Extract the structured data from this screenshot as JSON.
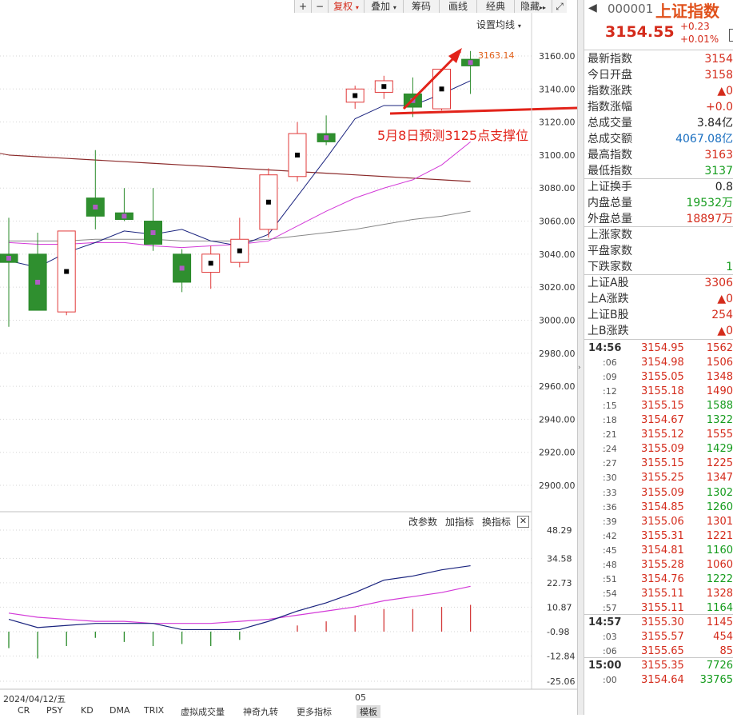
{
  "toolbar": {
    "plus": "+",
    "minus": "−",
    "fuquan": "复权",
    "diejia": "叠加",
    "chouma": "筹码",
    "huaxian": "画线",
    "jingdian": "经典",
    "yincang": "隐藏",
    "expand": "⤢"
  },
  "ma_setting": "设置均线",
  "annotation": "5月8日预测3125点支撑位",
  "high_label": "3163.14",
  "price_axis": [
    "3160.00",
    "3140.00",
    "3120.00",
    "3100.00",
    "3080.00",
    "3060.00",
    "3040.00",
    "3020.00",
    "3000.00",
    "2980.00",
    "2960.00",
    "2940.00",
    "2920.00",
    "2900.00"
  ],
  "indicator_toolbar": {
    "change_params": "改参数",
    "add_indicator": "加指标",
    "switch_indicator": "换指标",
    "close": "✕"
  },
  "indicator_axis": [
    "48.29",
    "34.58",
    "22.73",
    "10.87",
    "-0.98",
    "-12.84",
    "-25.06"
  ],
  "date_axis": {
    "start": "2024/04/12/五",
    "month": "05"
  },
  "bottom_tabs": [
    "CR",
    "PSY",
    "KD",
    "DMA",
    "TRIX",
    "虚拟成交量",
    "神奇九转",
    "更多指标",
    "模板"
  ],
  "header": {
    "code": "000001",
    "name": "上证指数",
    "price": "3154.55",
    "change": "+0.23",
    "change_pct": "+0.01%"
  },
  "quote": [
    {
      "label": "最新指数",
      "value": "3154",
      "color": "red"
    },
    {
      "label": "今日开盘",
      "value": "3158",
      "color": "red"
    },
    {
      "label": "指数涨跌",
      "value": "▲0",
      "color": "red"
    },
    {
      "label": "指数涨幅",
      "value": "+0.0",
      "color": "red"
    },
    {
      "label": "总成交量",
      "value": "3.84亿",
      "color": "black"
    },
    {
      "label": "总成交额",
      "value": "4067.08亿",
      "color": "blue"
    },
    {
      "label": "最高指数",
      "value": "3163",
      "color": "red"
    },
    {
      "label": "最低指数",
      "value": "3137",
      "color": "green"
    },
    {
      "label": "上证换手",
      "value": "0.8",
      "color": "black"
    },
    {
      "label": "内盘总量",
      "value": "19532万",
      "color": "green"
    },
    {
      "label": "外盘总量",
      "value": "18897万",
      "color": "red"
    },
    {
      "label": "上涨家数",
      "value": "",
      "color": "red"
    },
    {
      "label": "平盘家数",
      "value": "",
      "color": "black"
    },
    {
      "label": "下跌家数",
      "value": "1",
      "color": "green"
    },
    {
      "label": "上证A股",
      "value": "3306",
      "color": "red"
    },
    {
      "label": "上A涨跌",
      "value": "▲0",
      "color": "red"
    },
    {
      "label": "上证B股",
      "value": "254",
      "color": "red"
    },
    {
      "label": "上B涨跌",
      "value": "▲0",
      "color": "red"
    }
  ],
  "ticks": [
    {
      "time": "14:56",
      "price": "3154.95",
      "vol": "1562",
      "color": "red",
      "major": true
    },
    {
      "time": ":06",
      "price": "3154.98",
      "vol": "1506",
      "color": "red"
    },
    {
      "time": ":09",
      "price": "3155.05",
      "vol": "1348",
      "color": "red"
    },
    {
      "time": ":12",
      "price": "3155.18",
      "vol": "1490",
      "color": "red"
    },
    {
      "time": ":15",
      "price": "3155.15",
      "vol": "1588",
      "color": "green"
    },
    {
      "time": ":18",
      "price": "3154.67",
      "vol": "1322",
      "color": "green"
    },
    {
      "time": ":21",
      "price": "3155.12",
      "vol": "1555",
      "color": "red"
    },
    {
      "time": ":24",
      "price": "3155.09",
      "vol": "1429",
      "color": "green"
    },
    {
      "time": ":27",
      "price": "3155.15",
      "vol": "1225",
      "color": "red"
    },
    {
      "time": ":30",
      "price": "3155.25",
      "vol": "1347",
      "color": "red"
    },
    {
      "time": ":33",
      "price": "3155.09",
      "vol": "1302",
      "color": "green"
    },
    {
      "time": ":36",
      "price": "3154.85",
      "vol": "1260",
      "color": "green"
    },
    {
      "time": ":39",
      "price": "3155.06",
      "vol": "1301",
      "color": "red"
    },
    {
      "time": ":42",
      "price": "3155.31",
      "vol": "1221",
      "color": "red"
    },
    {
      "time": ":45",
      "price": "3154.81",
      "vol": "1160",
      "color": "green"
    },
    {
      "time": ":48",
      "price": "3155.28",
      "vol": "1060",
      "color": "red"
    },
    {
      "time": ":51",
      "price": "3154.76",
      "vol": "1222",
      "color": "green"
    },
    {
      "time": ":54",
      "price": "3155.11",
      "vol": "1328",
      "color": "red"
    },
    {
      "time": ":57",
      "price": "3155.11",
      "vol": "1164",
      "color": "green"
    },
    {
      "time": "14:57",
      "price": "3155.30",
      "vol": "1145",
      "color": "red",
      "major": true
    },
    {
      "time": ":03",
      "price": "3155.57",
      "vol": "454",
      "color": "red"
    },
    {
      "time": ":06",
      "price": "3155.65",
      "vol": "85",
      "color": "red"
    },
    {
      "time": "15:00",
      "price": "3155.35",
      "vol": "7726",
      "color": "green",
      "major": true
    },
    {
      "time": ":00",
      "price": "3154.64",
      "vol": "33765",
      "color": "green"
    }
  ],
  "chart_data": {
    "type": "candlestick",
    "candles": [
      {
        "o": 3040,
        "h": 3062,
        "l": 2996,
        "c": 3035
      },
      {
        "o": 3040,
        "h": 3053,
        "l": 3006,
        "c": 3006
      },
      {
        "o": 3005,
        "h": 3054,
        "l": 3003,
        "c": 3054
      },
      {
        "o": 3074,
        "h": 3103,
        "l": 3055,
        "c": 3063
      },
      {
        "o": 3065,
        "h": 3080,
        "l": 3060,
        "c": 3061
      },
      {
        "o": 3060,
        "h": 3080,
        "l": 3042,
        "c": 3046
      },
      {
        "o": 3040,
        "h": 3043,
        "l": 3017,
        "c": 3023
      },
      {
        "o": 3029,
        "h": 3045,
        "l": 3019,
        "c": 3040
      },
      {
        "o": 3035,
        "h": 3062,
        "l": 3032,
        "c": 3049
      },
      {
        "o": 3055,
        "h": 3092,
        "l": 3050,
        "c": 3088
      },
      {
        "o": 3087,
        "h": 3120,
        "l": 3084,
        "c": 3113
      },
      {
        "o": 3113,
        "h": 3124,
        "l": 3106,
        "c": 3108
      },
      {
        "o": 3132,
        "h": 3142,
        "l": 3128,
        "c": 3140
      },
      {
        "o": 3138,
        "h": 3148,
        "l": 3134,
        "c": 3145
      },
      {
        "o": 3137,
        "h": 3147,
        "l": 3123,
        "c": 3129
      },
      {
        "o": 3128,
        "h": 3150,
        "l": 3127,
        "c": 3152
      },
      {
        "o": 3158,
        "h": 3163,
        "l": 3137,
        "c": 3154
      }
    ],
    "ma_short": [
      3036,
      3032,
      3041,
      3047,
      3054,
      3052,
      3055,
      3048,
      3045,
      3052,
      3075,
      3098,
      3122,
      3130,
      3130,
      3137,
      3145
    ],
    "ma_mid": [
      3047,
      3046,
      3046,
      3047,
      3047,
      3045,
      3044,
      3045,
      3046,
      3048,
      3057,
      3066,
      3074,
      3080,
      3085,
      3094,
      3108
    ],
    "ma_long": [
      3100,
      3099,
      3098,
      3097,
      3096,
      3095,
      3094,
      3093,
      3092,
      3091,
      3090,
      3089,
      3088,
      3087,
      3086,
      3085,
      3084
    ],
    "ma_slow": [
      3048,
      3048,
      3048,
      3049,
      3049,
      3049,
      3048,
      3048,
      3048,
      3049,
      3051,
      3053,
      3055,
      3058,
      3061,
      3063,
      3066
    ],
    "indicator": {
      "line1": [
        5,
        1,
        2,
        3,
        3,
        3,
        0,
        0,
        0,
        4,
        9,
        13,
        18,
        24,
        26,
        29,
        31
      ],
      "line2": [
        8,
        6,
        5,
        4,
        4,
        3,
        3,
        3,
        4,
        5,
        7,
        9,
        11,
        14,
        16,
        18,
        21
      ],
      "bars": [
        -9,
        -14,
        -8,
        -4,
        -6,
        -8,
        -7,
        -8,
        -5,
        -1,
        2,
        4,
        7,
        10,
        10,
        11,
        12
      ]
    }
  }
}
